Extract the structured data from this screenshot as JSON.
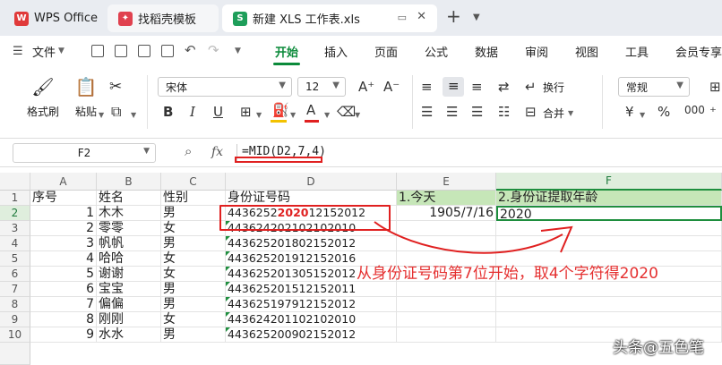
{
  "tabs": [
    {
      "label": "WPS Office"
    },
    {
      "label": "找稻壳模板"
    },
    {
      "label": "新建 XLS 工作表.xls"
    }
  ],
  "tab_add": "+",
  "menu": {
    "file": "文件",
    "items": [
      "开始",
      "插入",
      "页面",
      "公式",
      "数据",
      "审阅",
      "视图",
      "工具",
      "会员专享"
    ]
  },
  "ribbon": {
    "format_painter": "格式刷",
    "paste": "粘贴",
    "font_name": "宋体",
    "font_size": "12",
    "bold": "B",
    "italic": "I",
    "underline": "U",
    "font_color": "A",
    "wrap": "换行",
    "merge": "合并",
    "number_format": "常规",
    "currency": "¥",
    "percent": "%"
  },
  "formula_bar": {
    "cell_ref": "F2",
    "fx": "fx",
    "formula": "=MID(D2,7,4)"
  },
  "columns": [
    "A",
    "B",
    "C",
    "D",
    "E",
    "F"
  ],
  "header_row": {
    "A": "序号",
    "B": "姓名",
    "C": "性别",
    "D": "身份证号码",
    "E": "1.今天",
    "F": "2.身份证提取年龄"
  },
  "rows": [
    {
      "num": "2",
      "A": "1",
      "B": "木木",
      "C": "男",
      "D_pre": "4436252",
      "D_hl": "2020",
      "D_post": "12152012",
      "E": "1905/7/16",
      "F": "2020"
    },
    {
      "num": "3",
      "A": "2",
      "B": "零零",
      "C": "女",
      "D": "443624202102102010"
    },
    {
      "num": "4",
      "A": "3",
      "B": "帆帆",
      "C": "男",
      "D": "443625201802152012"
    },
    {
      "num": "5",
      "A": "4",
      "B": "哈哈",
      "C": "女",
      "D": "443625201912152016"
    },
    {
      "num": "6",
      "A": "5",
      "B": "谢谢",
      "C": "女",
      "D": "443625201305152012"
    },
    {
      "num": "7",
      "A": "6",
      "B": "宝宝",
      "C": "男",
      "D": "443625201512152011"
    },
    {
      "num": "8",
      "A": "7",
      "B": "偏偏",
      "C": "男",
      "D": "443625197912152012"
    },
    {
      "num": "9",
      "A": "8",
      "B": "刚刚",
      "C": "女",
      "D": "443624201102102010"
    },
    {
      "num": "10",
      "A": "9",
      "B": "水水",
      "C": "男",
      "D": "443625200902152012"
    }
  ],
  "annotation": "从身份证号码第7位开始，取4个字符得2020",
  "watermark": "头条@五色笔",
  "colors": {
    "accent": "#0b8a3a",
    "annotation": "#e02020",
    "header_fill": "#c6e6b8"
  }
}
